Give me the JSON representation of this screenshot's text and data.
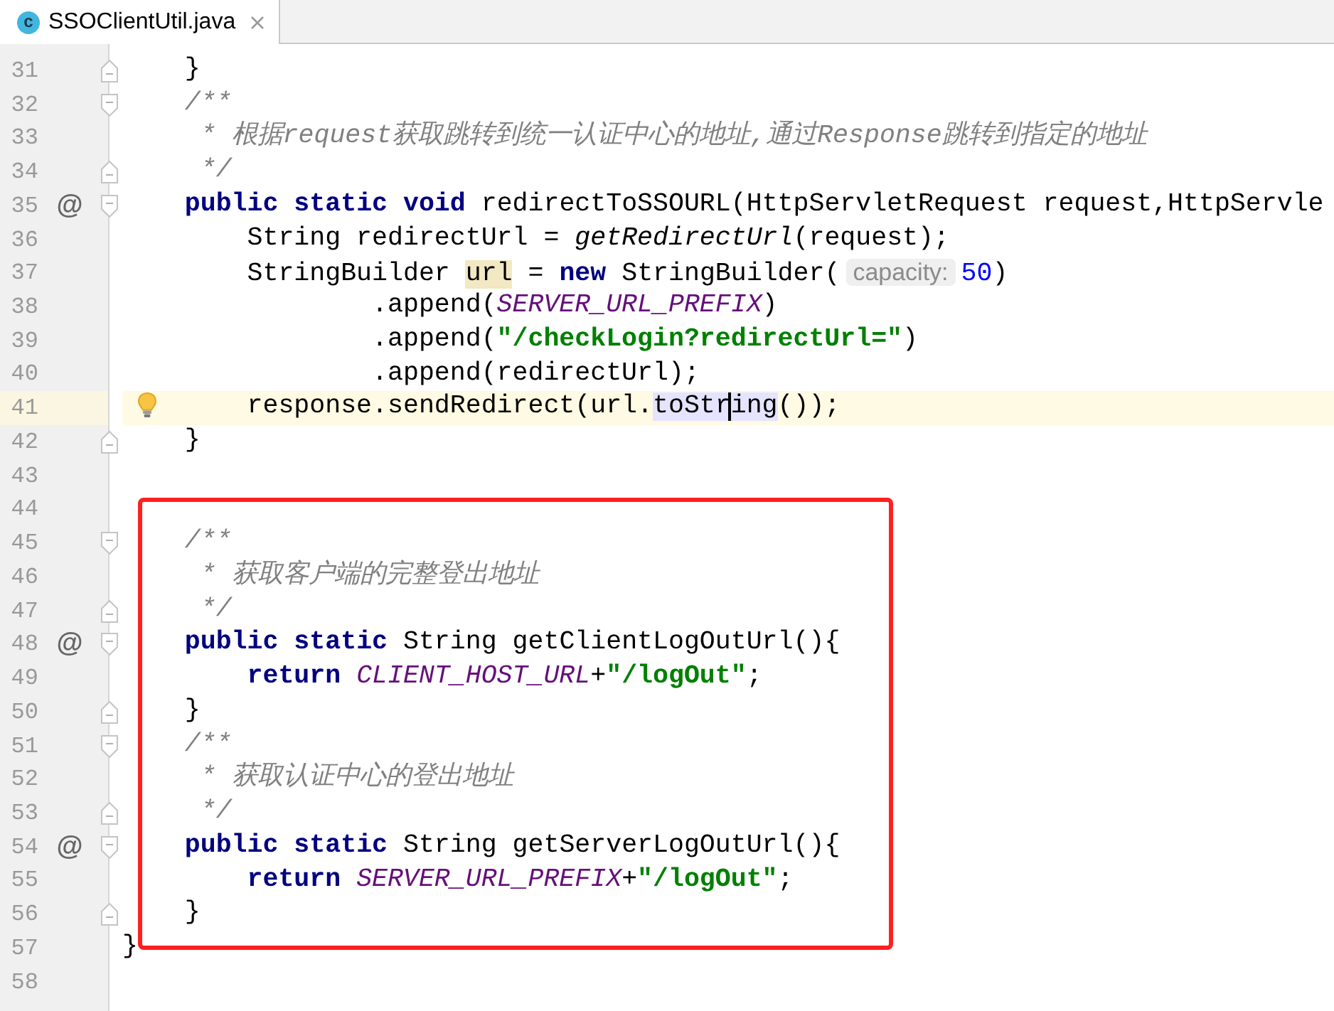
{
  "tab": {
    "badge": "c",
    "title": "SSOClientUtil.java",
    "selected": true
  },
  "blocks": [
    {
      "framed": false,
      "lines": [
        {
          "number": "31",
          "fold": {
            "kind": "end"
          },
          "current": false,
          "tokens": [
            {
              "kind": "plain",
              "text": "    }"
            }
          ]
        },
        {
          "number": "32",
          "fold": {
            "kind": "start"
          },
          "current": false,
          "tokens": [
            {
              "kind": "comment",
              "text": "    /**"
            }
          ]
        },
        {
          "number": "33",
          "current": false,
          "tokens": [
            {
              "kind": "comment",
              "text": "     * 根据request获取跳转到统一认证中心的地址,通过Response跳转到指定的地址"
            }
          ]
        },
        {
          "number": "34",
          "fold": {
            "kind": "end"
          },
          "current": false,
          "tokens": [
            {
              "kind": "comment",
              "text": "     */"
            }
          ]
        },
        {
          "number": "35",
          "mark": "@",
          "fold": {
            "kind": "start"
          },
          "current": false,
          "tokens": [
            {
              "kind": "keyword",
              "text": "    public static void"
            },
            {
              "kind": "plain",
              "text": " redirectToSSOURL(HttpServletRequest request,HttpServle"
            }
          ]
        },
        {
          "number": "36",
          "current": false,
          "tokens": [
            {
              "kind": "plain",
              "text": "        String redirectUrl = "
            },
            {
              "kind": "static-call",
              "text": "getRedirectUrl"
            },
            {
              "kind": "plain",
              "text": "(request);"
            }
          ]
        },
        {
          "number": "37",
          "current": false,
          "tokens": [
            {
              "kind": "plain",
              "text": "        StringBuilder "
            },
            {
              "kind": "match",
              "text": "url"
            },
            {
              "kind": "plain",
              "text": " = "
            },
            {
              "kind": "keyword",
              "text": "new"
            },
            {
              "kind": "plain",
              "text": " StringBuilder("
            },
            {
              "kind": "hint",
              "text": "capacity:"
            },
            {
              "kind": "number",
              "text": "50"
            },
            {
              "kind": "plain",
              "text": ")"
            }
          ]
        },
        {
          "number": "38",
          "current": false,
          "tokens": [
            {
              "kind": "plain",
              "text": "                .append("
            },
            {
              "kind": "constant",
              "text": "SERVER_URL_PREFIX"
            },
            {
              "kind": "plain",
              "text": ")"
            }
          ]
        },
        {
          "number": "39",
          "current": false,
          "tokens": [
            {
              "kind": "plain",
              "text": "                .append("
            },
            {
              "kind": "string",
              "text": "\"/checkLogin?redirectUrl=\""
            },
            {
              "kind": "plain",
              "text": ")"
            }
          ]
        },
        {
          "number": "40",
          "current": false,
          "tokens": [
            {
              "kind": "plain",
              "text": "                .append(redirectUrl);"
            }
          ]
        },
        {
          "number": "41",
          "current": true,
          "tokens": [
            {
              "kind": "plain",
              "text": "        response.sendRedirect(url."
            },
            {
              "kind": "usage",
              "text": "toStr",
              "caret": true
            },
            {
              "kind": "usage",
              "text": "ing"
            },
            {
              "kind": "plain",
              "text": "());"
            }
          ]
        },
        {
          "number": "42",
          "fold": {
            "kind": "end"
          },
          "current": false,
          "tokens": [
            {
              "kind": "plain",
              "text": "    }"
            }
          ]
        },
        {
          "number": "43",
          "current": false
        }
      ]
    },
    {
      "framed": true,
      "lines": [
        {
          "number": "44",
          "current": false
        },
        {
          "number": "45",
          "fold": {
            "kind": "start"
          },
          "current": false,
          "tokens": [
            {
              "kind": "comment",
              "text": "    /**"
            }
          ]
        },
        {
          "number": "46",
          "current": false,
          "tokens": [
            {
              "kind": "comment",
              "text": "     * 获取客户端的完整登出地址"
            }
          ]
        },
        {
          "number": "47",
          "fold": {
            "kind": "end"
          },
          "current": false,
          "tokens": [
            {
              "kind": "comment",
              "text": "     */"
            }
          ]
        },
        {
          "number": "48",
          "mark": "@",
          "fold": {
            "kind": "start"
          },
          "current": false,
          "tokens": [
            {
              "kind": "keyword",
              "text": "    public static"
            },
            {
              "kind": "plain",
              "text": " String getClientLogOutUrl(){"
            }
          ]
        },
        {
          "number": "49",
          "current": false,
          "tokens": [
            {
              "kind": "keyword",
              "text": "        return "
            },
            {
              "kind": "constant",
              "text": "CLIENT_HOST_URL"
            },
            {
              "kind": "plain",
              "text": "+"
            },
            {
              "kind": "string",
              "text": "\"/logOut\""
            },
            {
              "kind": "plain",
              "text": ";"
            }
          ]
        },
        {
          "number": "50",
          "fold": {
            "kind": "end"
          },
          "current": false,
          "tokens": [
            {
              "kind": "plain",
              "text": "    }"
            }
          ]
        },
        {
          "number": "51",
          "fold": {
            "kind": "start"
          },
          "current": false,
          "tokens": [
            {
              "kind": "comment",
              "text": "    /**"
            }
          ]
        },
        {
          "number": "52",
          "current": false,
          "tokens": [
            {
              "kind": "comment",
              "text": "     * 获取认证中心的登出地址"
            }
          ]
        },
        {
          "number": "53",
          "fold": {
            "kind": "end"
          },
          "current": false,
          "tokens": [
            {
              "kind": "comment",
              "text": "     */"
            }
          ]
        },
        {
          "number": "54",
          "mark": "@",
          "fold": {
            "kind": "start"
          },
          "current": false,
          "tokens": [
            {
              "kind": "keyword",
              "text": "    public static"
            },
            {
              "kind": "plain",
              "text": " String getServerLogOutUrl(){"
            }
          ]
        },
        {
          "number": "55",
          "current": false,
          "tokens": [
            {
              "kind": "keyword",
              "text": "        return "
            },
            {
              "kind": "constant",
              "text": "SERVER_URL_PREFIX"
            },
            {
              "kind": "plain",
              "text": "+"
            },
            {
              "kind": "string",
              "text": "\"/logOut\""
            },
            {
              "kind": "plain",
              "text": ";"
            }
          ]
        },
        {
          "number": "56",
          "fold": {
            "kind": "end"
          },
          "current": false,
          "tokens": [
            {
              "kind": "plain",
              "text": "    }"
            }
          ]
        }
      ]
    },
    {
      "framed": false,
      "lines": [
        {
          "number": "57",
          "current": false,
          "tokens": [
            {
              "kind": "plain",
              "text": "}"
            }
          ]
        },
        {
          "number": "58",
          "current": false
        }
      ]
    }
  ]
}
